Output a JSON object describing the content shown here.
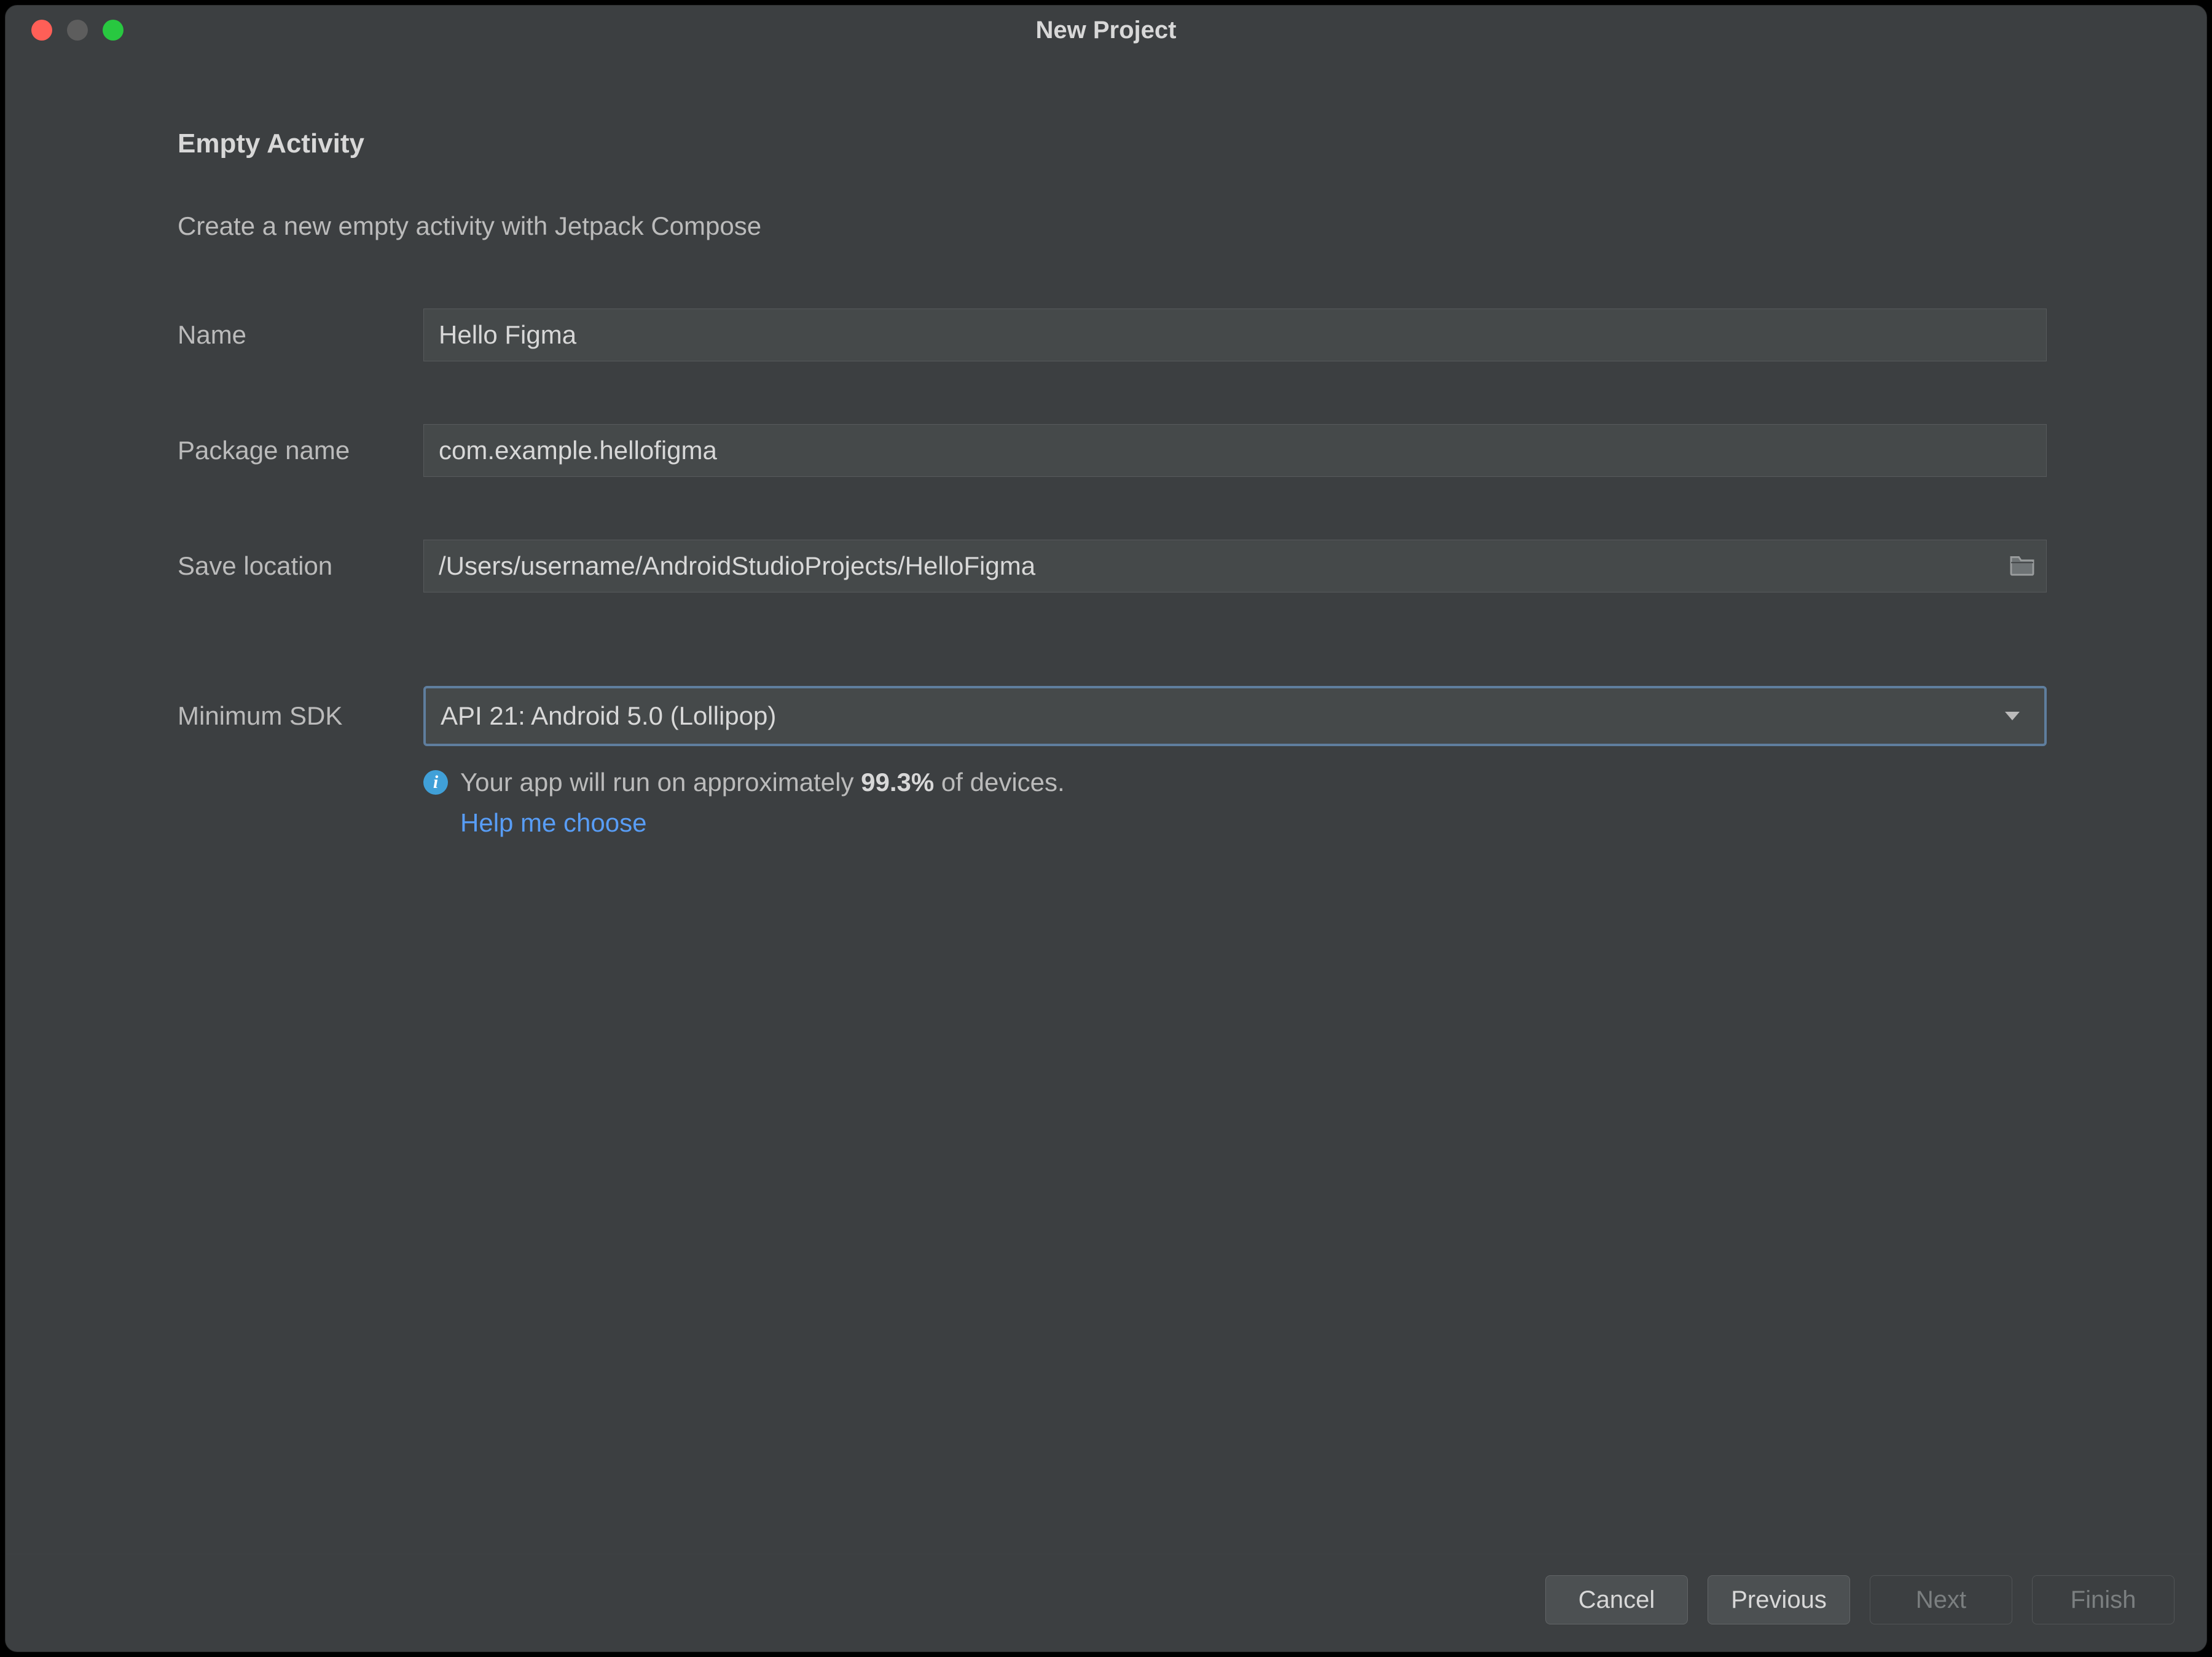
{
  "window": {
    "title": "New Project"
  },
  "header": {
    "heading": "Empty Activity",
    "subheading": "Create a new empty activity with Jetpack Compose"
  },
  "form": {
    "name": {
      "label": "Name",
      "value": "Hello Figma"
    },
    "package": {
      "label": "Package name",
      "value": "com.example.hellofigma"
    },
    "location": {
      "label": "Save location",
      "value": "/Users/username/AndroidStudioProjects/HelloFigma"
    },
    "sdk": {
      "label": "Minimum SDK",
      "selected": "API 21: Android 5.0 (Lollipop)",
      "info_prefix": "Your app will run on approximately ",
      "info_percent": "99.3%",
      "info_suffix": " of devices.",
      "help": "Help me choose"
    }
  },
  "footer": {
    "cancel": "Cancel",
    "previous": "Previous",
    "next": "Next",
    "finish": "Finish"
  }
}
